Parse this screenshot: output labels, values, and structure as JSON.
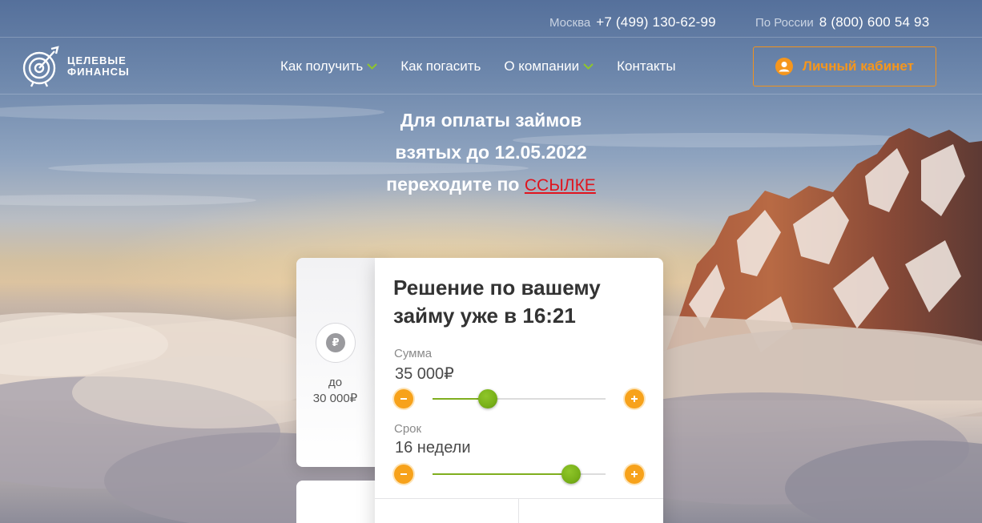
{
  "contacts": {
    "moscow": {
      "city": "Москва",
      "phone": "+7 (499) 130-62-99"
    },
    "russia": {
      "city": "По России",
      "phone": "8 (800) 600 54 93"
    }
  },
  "logo": {
    "line1": "ЦЕЛЕВЫЕ",
    "line2": "ФИНАНСЫ"
  },
  "nav": {
    "items": [
      {
        "label": "Как получить",
        "has_dropdown": true
      },
      {
        "label": "Как погасить",
        "has_dropdown": false
      },
      {
        "label": "О компании",
        "has_dropdown": true
      },
      {
        "label": "Контакты",
        "has_dropdown": false
      }
    ],
    "cabinet_label": "Личный кабинет"
  },
  "notice": {
    "line1": "Для оплаты займов",
    "line2": "взятых до 12.05.2022",
    "line3": "переходите по",
    "link_text": "ССЫЛКЕ"
  },
  "side_card": {
    "icon": "ruble-icon",
    "icon_glyph": "₽",
    "line1": "до",
    "line2": "30 000₽"
  },
  "calculator": {
    "title": "Решение по вашему займу уже в 16:21",
    "amount": {
      "label": "Сумма",
      "value": "35 000₽",
      "slider_fraction": 0.32
    },
    "term": {
      "label": "Срок",
      "value": "16 недели",
      "slider_fraction": 0.8
    }
  },
  "colors": {
    "accent_orange": "#f5961d",
    "slider_green": "#7fae1f",
    "link_red": "#e0141e"
  }
}
